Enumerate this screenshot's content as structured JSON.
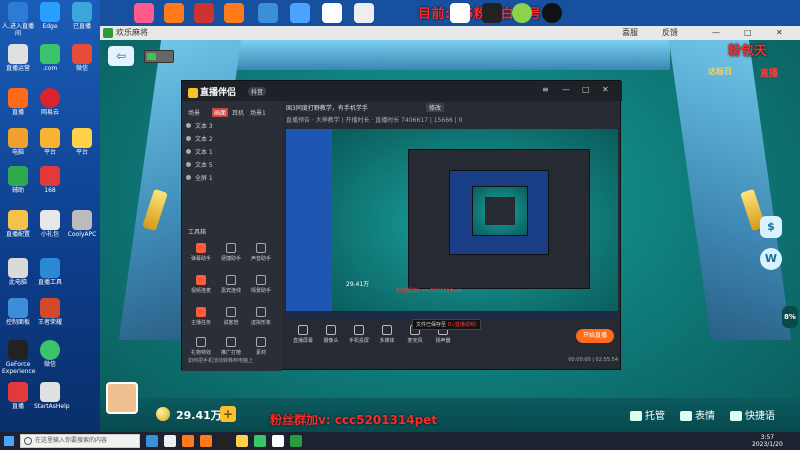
{
  "top_banner": "目前:电6粉丝白金号",
  "game": {
    "title": "欢乐麻将",
    "toolbar": {
      "notice": "喜服",
      "feedback": "反馈"
    },
    "fan_banner": "粉包天",
    "fan_sub": "达标日",
    "fan_sub2": "直播",
    "coins": "29.41万",
    "wechat": "粉丝群加v: ccc5201314pet",
    "bottom_buttons": [
      "托管",
      "表情",
      "快捷语"
    ],
    "side_badge": "8%"
  },
  "live_app": {
    "logo": "直播伴侣",
    "tag": "抖音",
    "left_tabs": [
      "场景",
      "画面",
      "耳机",
      "场景1"
    ],
    "layers": [
      "文本 3",
      "文本 2",
      "文本 1",
      "文本 5",
      "全屏 1"
    ],
    "tools_label": "工具箱",
    "tools": [
      "弹幕助手",
      "便捷助手",
      "声音助手",
      "视频连麦",
      "嘉宾连线",
      "情景助手",
      "主播任务",
      "说客管",
      "虚拟形象",
      "礼物特效",
      "推广打榜",
      "素材"
    ],
    "hint": "如何把手机活动转移到电脑上",
    "info_line1": "国3同度打野教学，有手机学手",
    "info_btn": "修改",
    "info_line2": "直播预告 · 大神教学 | 开播时长 · 直播时长 7406617 | 15666 | 0",
    "preview_note": "粉丝群加V: ccc5201314pet",
    "preview_coin": "29.41万",
    "actions": [
      "直播屏幕",
      "摄像头",
      "手机投屏",
      "多媒体",
      "麦克风",
      "扬声器"
    ],
    "start_label": "开始直播",
    "tooltip": "文件已保存至",
    "tooltip_red": "D:/直播视频/",
    "status": "00:00:00  |  02:55:54"
  },
  "taskbar": {
    "search_placeholder": "在这里输入你要搜索的内容",
    "time": "3:57",
    "date": "2023/1/20"
  }
}
